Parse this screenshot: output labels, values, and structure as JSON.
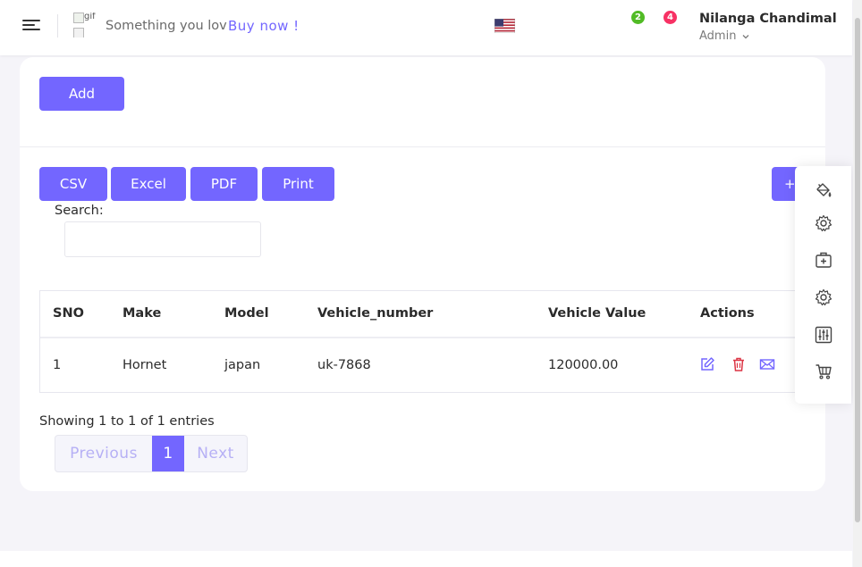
{
  "header": {
    "menu_icon": "hamburger-menu-icon",
    "logo_alt": "gif",
    "marquee_text": "Something you lov",
    "buy_link": "Buy now !",
    "language_flag": "us-flag-icon",
    "notification_count": "2",
    "message_count": "4",
    "user_name": "Nilanga Chandimal",
    "user_role": "Admin",
    "role_chevron": "⌄"
  },
  "card": {
    "add_label": "Add",
    "export_buttons": [
      "CSV",
      "Excel",
      "PDF",
      "Print"
    ],
    "add_column_label": "+ Add",
    "search_label": "Search:",
    "search_value": ""
  },
  "table": {
    "columns": [
      "SNO",
      "Make",
      "Model",
      "Vehicle_number",
      "Vehicle Value",
      "Actions"
    ],
    "rows": [
      {
        "sno": "1",
        "make": "Hornet",
        "model": "japan",
        "vehicle_number": "uk-7868",
        "vehicle_value": "120000.00",
        "actions": [
          "edit-icon",
          "delete-icon",
          "mail-icon"
        ]
      }
    ]
  },
  "footer": {
    "info": "Showing 1 to 1 of 1 entries",
    "previous": "Previous",
    "current_page": "1",
    "next": "Next"
  },
  "side_panel": {
    "icons": [
      "paint-bucket-icon",
      "settings-icon",
      "medical-box-icon",
      "settings-icon",
      "sliders-icon",
      "cart-icon"
    ]
  },
  "colors": {
    "primary": "#7366ff",
    "success": "#51bb25",
    "danger": "#f73164",
    "background": "#f5f4f9"
  }
}
